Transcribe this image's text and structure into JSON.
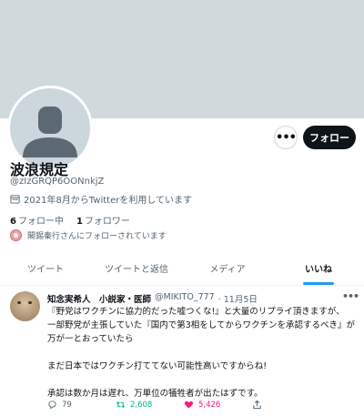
{
  "profile": {
    "name": "波浪規定",
    "handle": "@zIzGRQP6OONnkjZ",
    "joined": "2021年8月からTwitterを利用しています",
    "following_count": "6",
    "following_label": "フォロー中",
    "followers_count": "1",
    "followers_label": "フォロワー",
    "followed_by": "閣錫秦行さんにフォローされています",
    "follow_button": "フォロー",
    "more_button": "•••"
  },
  "tabs": [
    {
      "label": "ツイート",
      "active": false
    },
    {
      "label": "ツイートと返信",
      "active": false
    },
    {
      "label": "メディア",
      "active": false
    },
    {
      "label": "いいね",
      "active": true
    }
  ],
  "tweet": {
    "author": "知念実希人　小説家・医師",
    "handle": "@MIKITO_777",
    "date": "· 11月5日",
    "lines": [
      "『野党はワクチンに協力的だった嘘つくな!』と大量のリプライ頂きますが、",
      "一部野党が主張していた『国内で第3相をしてからワクチンを承認するべき』が",
      "万が一とおっていたら",
      "",
      "まだ日本ではワクチン打ててない可能性高いですからね!",
      "",
      "承認は数か月は遅れ、万単位の犠牲者が出たはずです。"
    ],
    "reply_count": "79",
    "retweet_count": "2,608",
    "like_count": "5,426"
  },
  "colors": {
    "banner": "#cfd9de",
    "accent": "#1d9bf0",
    "retweet": "#00ba7c",
    "like": "#f91880"
  }
}
